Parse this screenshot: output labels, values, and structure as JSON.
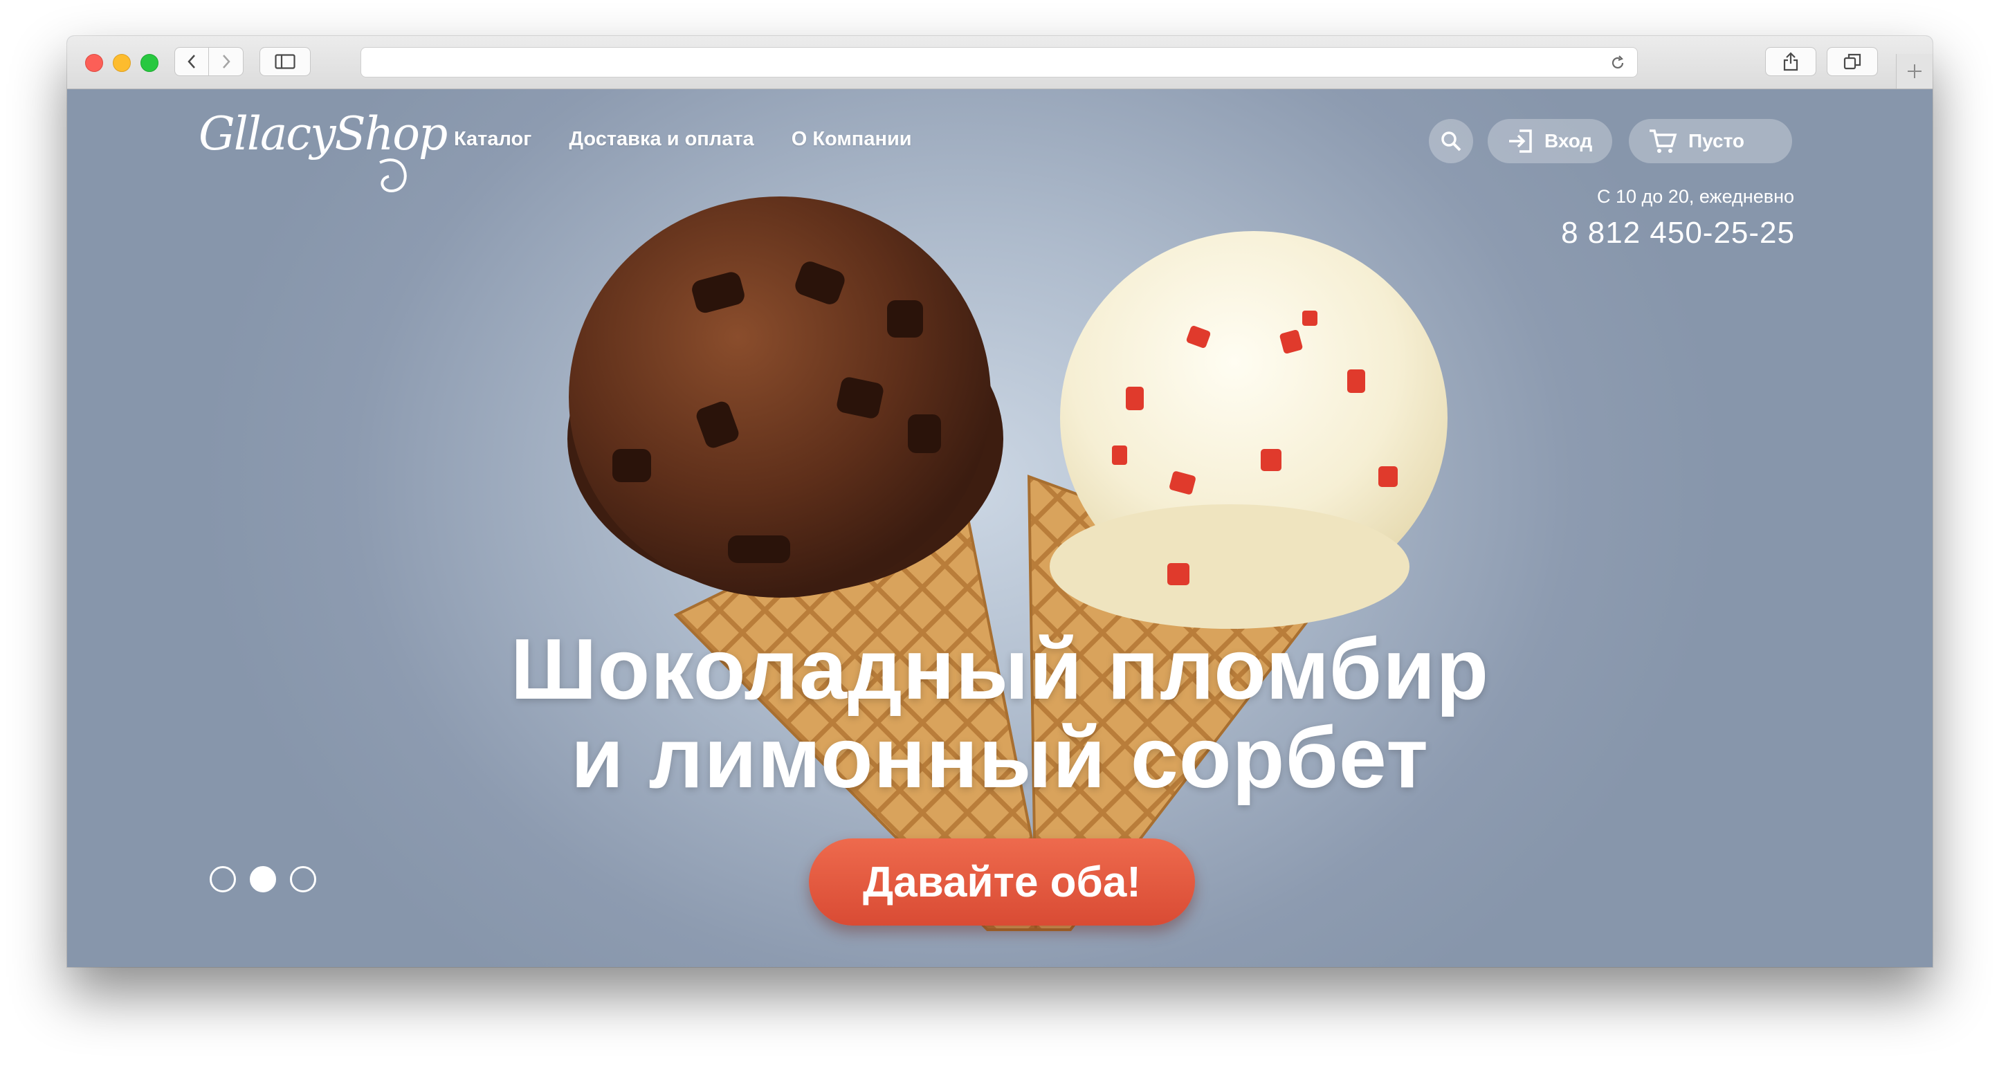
{
  "site": {
    "logo_text": "GllacyShop",
    "nav": [
      {
        "label": "Каталог"
      },
      {
        "label": "Доставка и оплата"
      },
      {
        "label": "О Компании"
      }
    ],
    "login_label": "Вход",
    "cart_label": "Пусто",
    "hours": "С 10 до 20, ежедневно",
    "phone": "8 812 450-25-25"
  },
  "hero": {
    "headline_line1": "Шоколадный пломбир",
    "headline_line2": "и лимонный сорбет",
    "cta_label": "Давайте оба!",
    "slider_active_index": 1,
    "slider_count": 3
  },
  "colors": {
    "page_bg": "#8b9bb0",
    "cta": "#e2553b",
    "text": "#ffffff"
  }
}
